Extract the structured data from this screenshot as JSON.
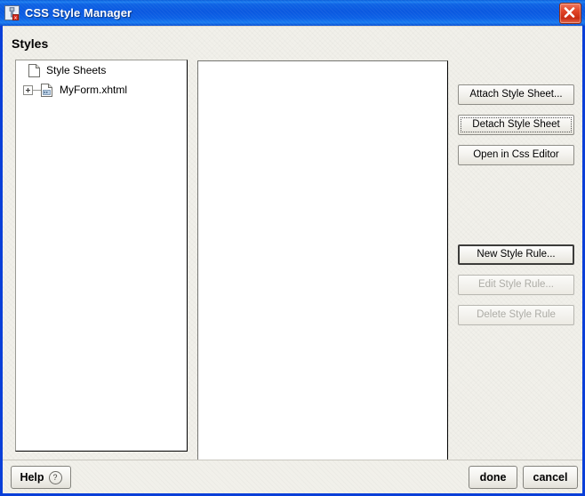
{
  "window": {
    "title": "CSS Style Manager",
    "title_icon": "app-icon",
    "close_icon": "close-icon",
    "titlebar_color": "#0a58e0",
    "close_color": "#c92c12",
    "background_color": "#f1f0ea"
  },
  "panel": {
    "heading": "Styles"
  },
  "tree": {
    "nodes": [
      {
        "label": "Style Sheets",
        "icon": "document-icon",
        "expandable": false,
        "level": 0
      },
      {
        "label": "MyForm.xhtml",
        "icon": "xhtml-document-icon",
        "expandable": true,
        "expander_state": "collapsed",
        "level": 1
      }
    ]
  },
  "scrollbar": {
    "left_arrow": "‹",
    "right_arrow": "›",
    "orientation": "horizontal",
    "thumb_position": "right"
  },
  "side_buttons": {
    "upper": [
      {
        "label": "Attach Style Sheet...",
        "state": "enabled"
      },
      {
        "label": "Detach Style Sheet",
        "state": "focused"
      },
      {
        "label": "Open in Css Editor",
        "state": "enabled"
      }
    ],
    "lower": [
      {
        "label": "New Style Rule...",
        "state": "default"
      },
      {
        "label": "Edit Style Rule...",
        "state": "disabled"
      },
      {
        "label": "Delete Style Rule",
        "state": "disabled"
      }
    ]
  },
  "footer": {
    "help_label": "Help",
    "help_icon": "question-mark-icon",
    "done_label": "done",
    "cancel_label": "cancel"
  }
}
